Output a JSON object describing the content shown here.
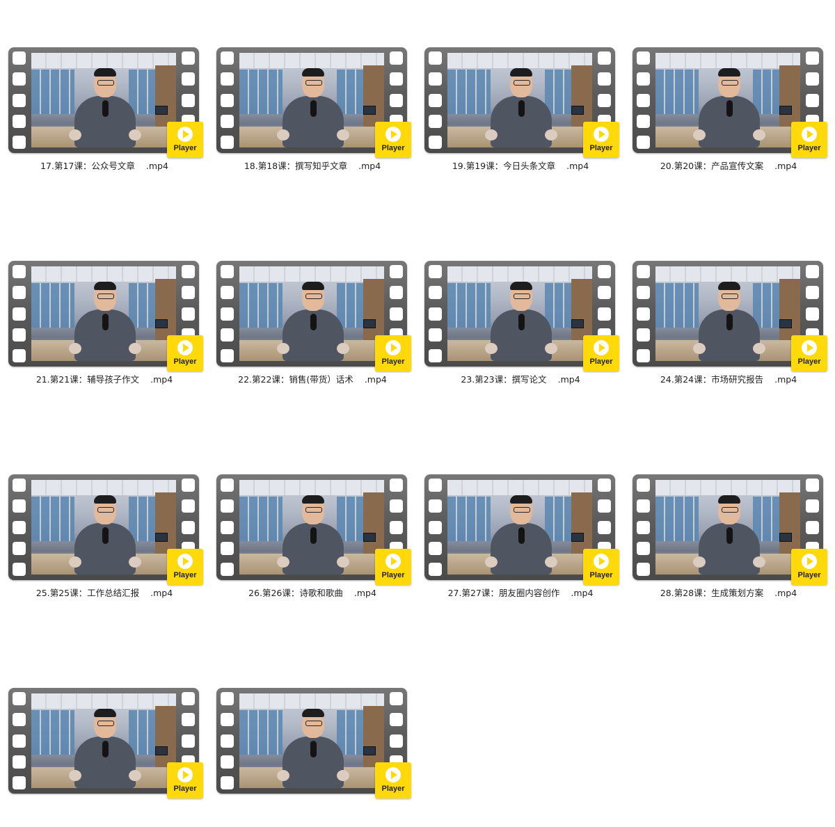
{
  "icon": "video-file-thumbnail",
  "player_label": "Player",
  "files": [
    {
      "name": "17.第17课：公众号文章",
      "ext": ".mp4"
    },
    {
      "name": "18.第18课：撰写知乎文章",
      "ext": ".mp4"
    },
    {
      "name": "19.第19课：今日头条文章",
      "ext": ".mp4"
    },
    {
      "name": "20.第20课：产品宣传文案",
      "ext": ".mp4"
    },
    {
      "name": "21.第21课：辅导孩子作文",
      "ext": ".mp4"
    },
    {
      "name": "22.第22课：销售(带货）话术",
      "ext": ".mp4"
    },
    {
      "name": "23.第23课：撰写论文",
      "ext": ".mp4"
    },
    {
      "name": "24.第24课：市场研究报告",
      "ext": ".mp4"
    },
    {
      "name": "25.第25课：工作总结汇报",
      "ext": ".mp4"
    },
    {
      "name": "26.第26课：诗歌和歌曲",
      "ext": ".mp4"
    },
    {
      "name": "27.第27课：朋友圈内容创作",
      "ext": ".mp4"
    },
    {
      "name": "28.第28课：生成策划方案",
      "ext": ".mp4"
    },
    {
      "name": "",
      "ext": ""
    },
    {
      "name": "",
      "ext": ""
    }
  ],
  "colors": {
    "background": "#ffffff",
    "film_strip": "#5b5b5b",
    "player_badge": "#ffd90a",
    "caption_text": "#222222"
  }
}
